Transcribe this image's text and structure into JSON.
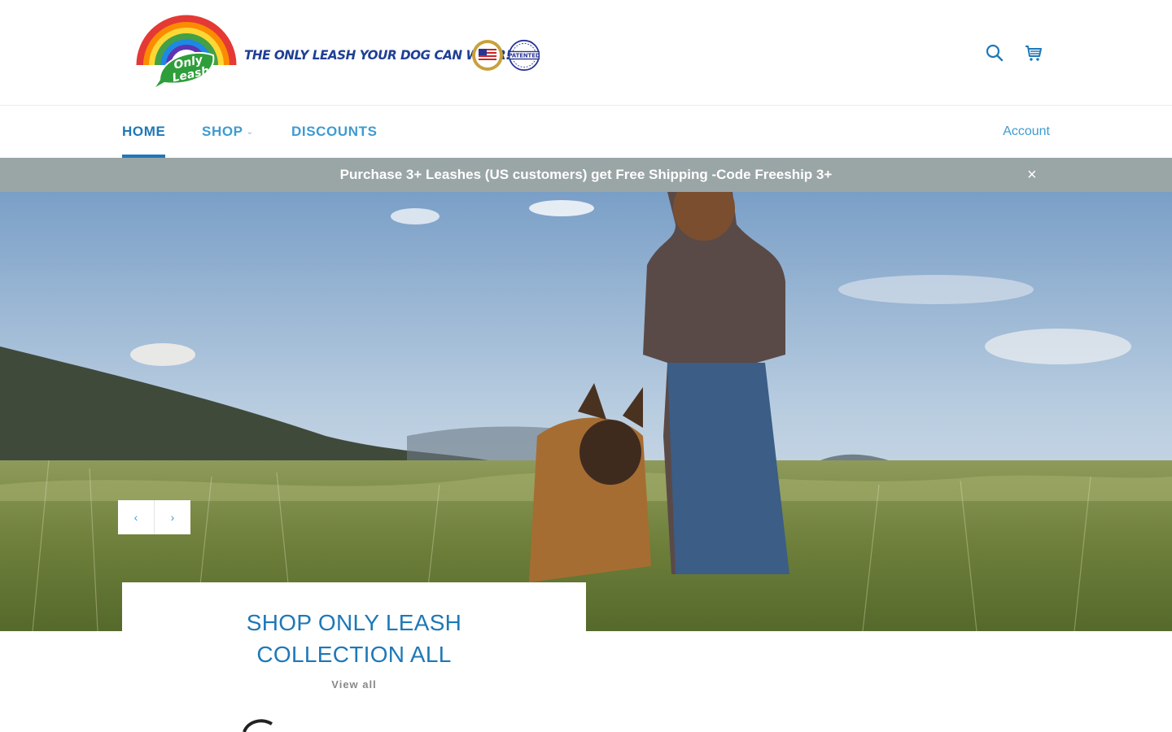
{
  "header": {
    "logo_text": "Only Leash",
    "tagline": "THE ONLY LEASH YOUR DOG CAN WEAR!",
    "seal_usa_text": "USA",
    "seal_patent_text": "PATENTED",
    "icons": [
      "search-icon",
      "cart-icon"
    ]
  },
  "nav": {
    "items": [
      {
        "label": "HOME",
        "active": true
      },
      {
        "label": "SHOP",
        "has_dropdown": true
      },
      {
        "label": "DISCOUNTS"
      }
    ],
    "account_label": "Account"
  },
  "announcement": {
    "text": "Purchase 3+ Leashes (US customers) get Free Shipping -Code Freeship 3+",
    "close_label": "×"
  },
  "slideshow": {
    "prev_label": "‹",
    "next_label": "›"
  },
  "collection": {
    "title": "SHOP ONLY LEASH COLLECTION ALL",
    "link_label": "View all"
  },
  "colors": {
    "accent": "#1e78b7",
    "nav_link": "#3e9bd1",
    "announcement_bg": "#9aa5a6",
    "tagline": "#1f3f95"
  }
}
